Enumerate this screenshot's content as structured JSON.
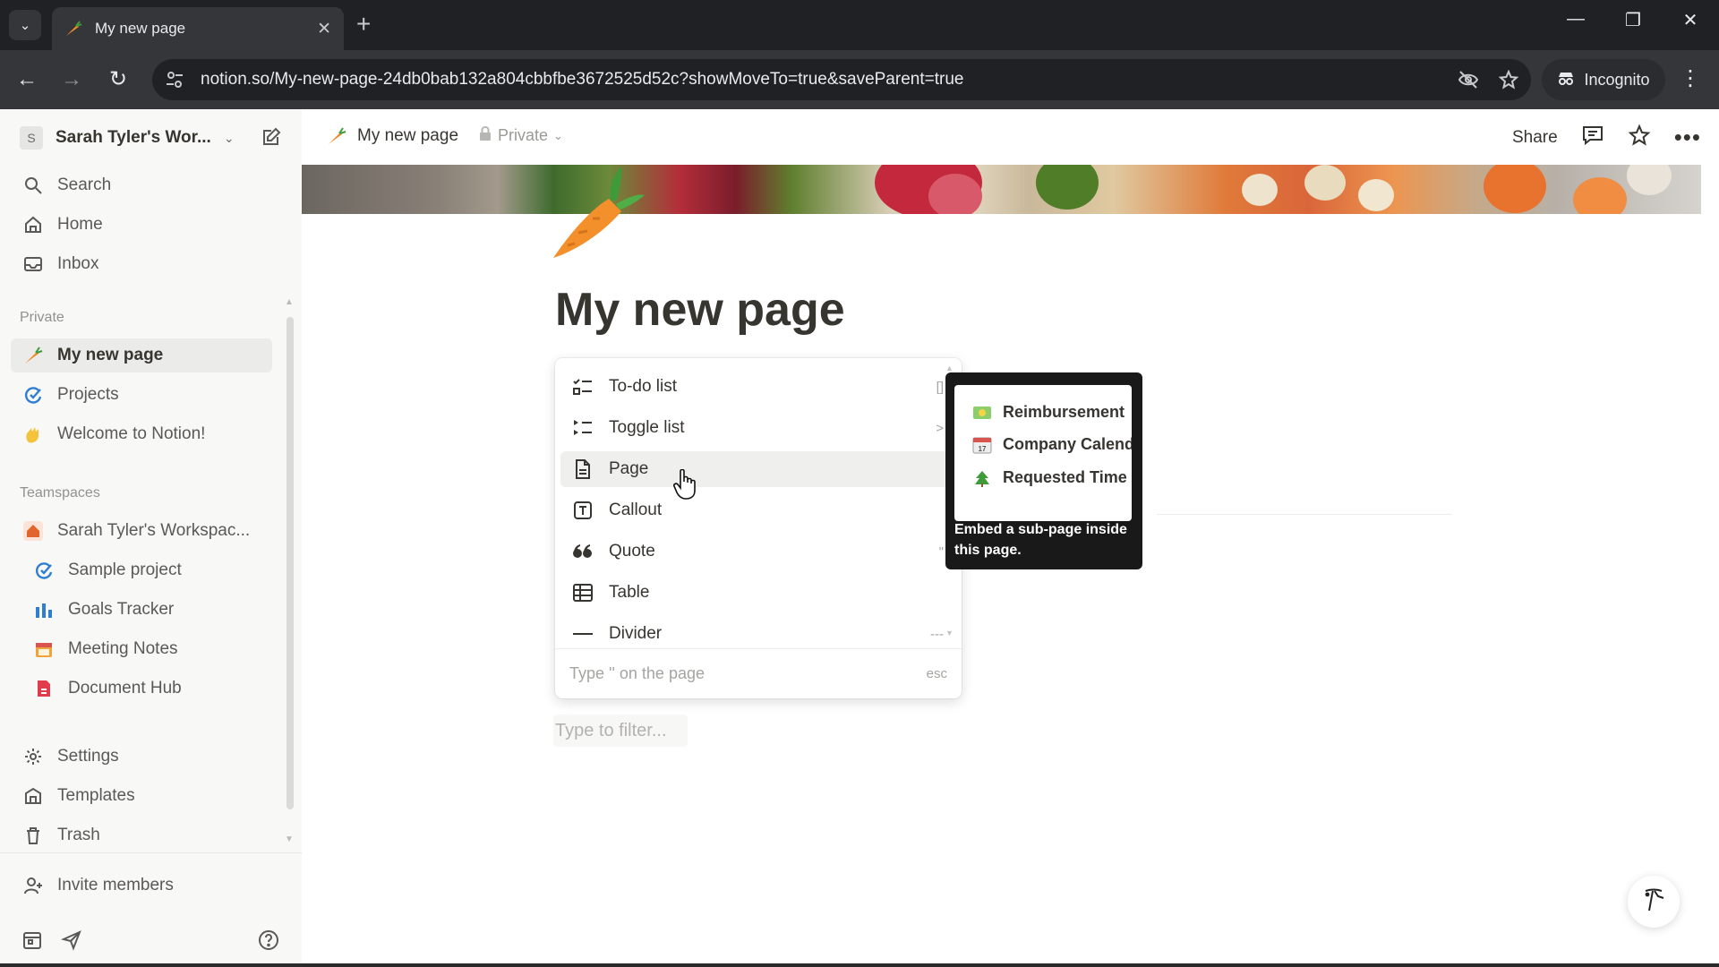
{
  "browser": {
    "tab_title": "My new page",
    "url": "notion.so/My-new-page-24db0bab132a804cbbfbe3672525d52c?showMoveTo=true&saveParent=true",
    "incognito_label": "Incognito"
  },
  "sidebar": {
    "workspace_initial": "S",
    "workspace_name": "Sarah Tyler's Wor...",
    "nav": [
      {
        "label": "Search",
        "icon": "search-icon"
      },
      {
        "label": "Home",
        "icon": "home-icon"
      },
      {
        "label": "Inbox",
        "icon": "inbox-icon"
      }
    ],
    "private_label": "Private",
    "private_pages": [
      {
        "label": "My new page",
        "icon": "carrot-icon",
        "active": true
      },
      {
        "label": "Projects",
        "icon": "projects-icon"
      },
      {
        "label": "Welcome to Notion!",
        "icon": "wave-hand-icon"
      }
    ],
    "teamspaces_label": "Teamspaces",
    "teamspace_name": "Sarah Tyler's Workspac...",
    "teamspace_pages": [
      {
        "label": "Sample project",
        "icon": "projects-icon"
      },
      {
        "label": "Goals Tracker",
        "icon": "goals-icon"
      },
      {
        "label": "Meeting Notes",
        "icon": "calendar-icon"
      },
      {
        "label": "Document Hub",
        "icon": "document-hub-icon"
      }
    ],
    "bottom_items": [
      {
        "label": "Settings",
        "icon": "gear-icon"
      },
      {
        "label": "Templates",
        "icon": "templates-icon"
      },
      {
        "label": "Trash",
        "icon": "trash-icon"
      }
    ],
    "invite_label": "Invite members"
  },
  "topbar": {
    "breadcrumb": "My new page",
    "privacy": "Private",
    "share_label": "Share"
  },
  "page": {
    "title": "My new page",
    "filter_placeholder": "Type to filter..."
  },
  "menu": {
    "items": [
      {
        "label": "To-do list",
        "icon": "todo-icon",
        "shortcut": "[]"
      },
      {
        "label": "Toggle list",
        "icon": "toggle-list-icon",
        "shortcut": ">"
      },
      {
        "label": "Page",
        "icon": "page-icon",
        "shortcut": ""
      },
      {
        "label": "Callout",
        "icon": "callout-icon",
        "shortcut": ""
      },
      {
        "label": "Quote",
        "icon": "quote-icon",
        "shortcut": "\""
      },
      {
        "label": "Table",
        "icon": "table-icon",
        "shortcut": ""
      },
      {
        "label": "Divider",
        "icon": "divider-icon",
        "shortcut": "---"
      }
    ],
    "footer_hint": "Type '' on the page",
    "footer_esc": "esc"
  },
  "tooltip": {
    "preview_rows": [
      "Reimbursement",
      "Company Calendar",
      "Requested Time"
    ],
    "description": "Embed a sub-page inside this page."
  }
}
